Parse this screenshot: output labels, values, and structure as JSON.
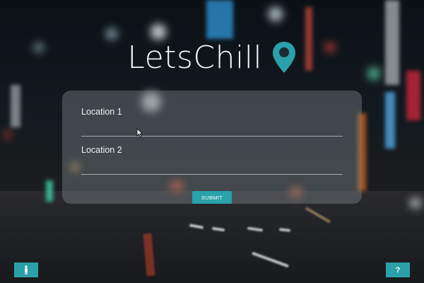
{
  "app": {
    "title": "LetsChill"
  },
  "form": {
    "location_1": {
      "label": "Location 1",
      "value": ""
    },
    "location_2": {
      "label": "Location 2",
      "value": ""
    },
    "submit_label": "SUBMIT"
  },
  "corner_buttons": {
    "left_icon": "person-icon",
    "right_label": "?"
  },
  "colors": {
    "accent": "#2aa3aa",
    "logo_pin": "#2ba0a8",
    "logo_text": "#f4f7f8"
  }
}
